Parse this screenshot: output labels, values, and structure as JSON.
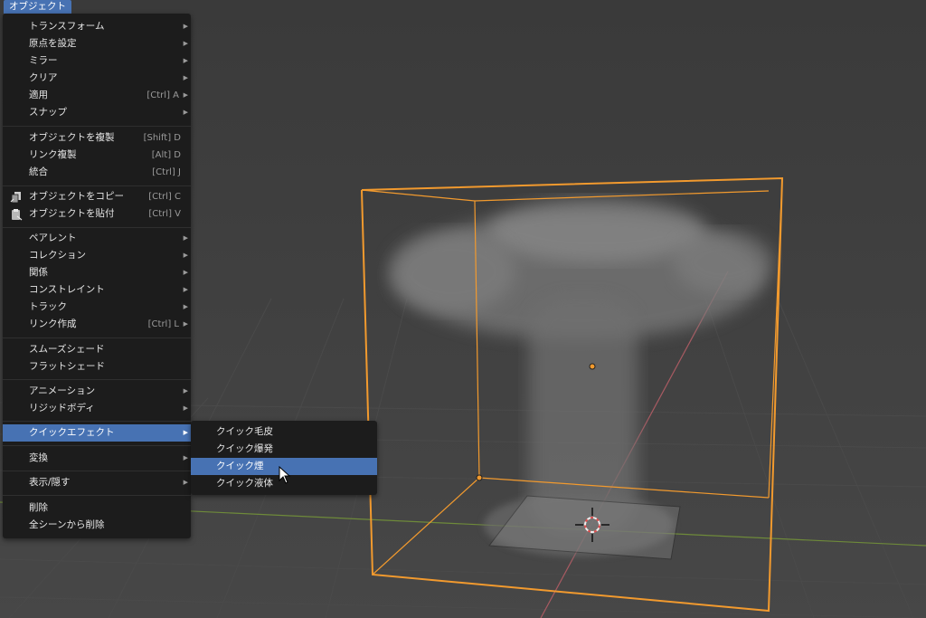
{
  "menu_title": "オブジェクト",
  "main_menu": {
    "items": [
      {
        "label": "トランスフォーム",
        "shortcut": "",
        "submenu": true
      },
      {
        "label": "原点を設定",
        "shortcut": "",
        "submenu": true
      },
      {
        "label": "ミラー",
        "shortcut": "",
        "submenu": true
      },
      {
        "label": "クリア",
        "shortcut": "",
        "submenu": true
      },
      {
        "label": "適用",
        "shortcut": "[Ctrl] A",
        "submenu": true
      },
      {
        "label": "スナップ",
        "shortcut": "",
        "submenu": true
      },
      {
        "label": "オブジェクトを複製",
        "shortcut": "[Shift] D",
        "submenu": false
      },
      {
        "label": "リンク複製",
        "shortcut": "[Alt] D",
        "submenu": false
      },
      {
        "label": "統合",
        "shortcut": "[Ctrl] J",
        "submenu": false
      },
      {
        "label": "オブジェクトをコピー",
        "shortcut": "[Ctrl] C",
        "submenu": false,
        "icon": "copy-icon"
      },
      {
        "label": "オブジェクトを貼付",
        "shortcut": "[Ctrl] V",
        "submenu": false,
        "icon": "paste-icon"
      },
      {
        "label": "ペアレント",
        "shortcut": "",
        "submenu": true
      },
      {
        "label": "コレクション",
        "shortcut": "",
        "submenu": true
      },
      {
        "label": "関係",
        "shortcut": "",
        "submenu": true
      },
      {
        "label": "コンストレイント",
        "shortcut": "",
        "submenu": true
      },
      {
        "label": "トラック",
        "shortcut": "",
        "submenu": true
      },
      {
        "label": "リンク作成",
        "shortcut": "[Ctrl] L",
        "submenu": true
      },
      {
        "label": "スムーズシェード",
        "shortcut": "",
        "submenu": false
      },
      {
        "label": "フラットシェード",
        "shortcut": "",
        "submenu": false
      },
      {
        "label": "アニメーション",
        "shortcut": "",
        "submenu": true
      },
      {
        "label": "リジッドボディ",
        "shortcut": "",
        "submenu": true
      },
      {
        "label": "クイックエフェクト",
        "shortcut": "",
        "submenu": true,
        "highlighted": true
      },
      {
        "label": "変換",
        "shortcut": "",
        "submenu": true
      },
      {
        "label": "表示/隠す",
        "shortcut": "",
        "submenu": true
      },
      {
        "label": "削除",
        "shortcut": "",
        "submenu": false
      },
      {
        "label": "全シーンから削除",
        "shortcut": "",
        "submenu": false
      }
    ]
  },
  "quick_effects_menu": {
    "items": [
      {
        "label": "クイック毛皮"
      },
      {
        "label": "クイック爆発"
      },
      {
        "label": "クイック煙",
        "highlighted": true
      },
      {
        "label": "クイック液体"
      }
    ]
  },
  "colors": {
    "highlight": "#4772b3",
    "menu_bg": "#1c1c1c",
    "viewport_bg": "#3d3d3d",
    "selection": "#f29a2e",
    "x_axis": "#b2555c",
    "y_axis": "#7a9a3c"
  }
}
